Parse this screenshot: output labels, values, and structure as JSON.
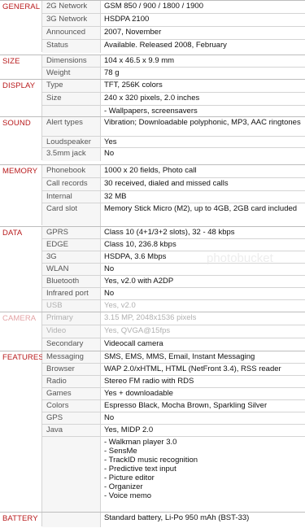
{
  "sections": [
    {
      "category": "GENERAL",
      "rows": [
        {
          "label": "2G Network",
          "value": "GSM 850 / 900 / 1800 / 1900"
        },
        {
          "label": "3G Network",
          "value": "HSDPA 2100"
        },
        {
          "label": "Announced",
          "value": "2007, November"
        },
        {
          "label": "Status",
          "value": "Available. Released 2008, February"
        }
      ]
    },
    {
      "category": "SIZE",
      "rows": [
        {
          "label": "Dimensions",
          "value": "104 x 46.5 x 9.9 mm"
        },
        {
          "label": "Weight",
          "value": "78 g"
        }
      ]
    },
    {
      "category": "DISPLAY",
      "rows": [
        {
          "label": "Type",
          "value": "TFT, 256K colors"
        },
        {
          "label": "Size",
          "value": "240 x 320 pixels, 2.0 inches"
        },
        {
          "label": "",
          "value": "- Wallpapers, screensavers"
        }
      ]
    },
    {
      "category": "SOUND",
      "rows": [
        {
          "label": "Alert types",
          "value": "Vibration; Downloadable polyphonic, MP3, AAC ringtones"
        },
        {
          "label": "Loudspeaker",
          "value": "Yes"
        },
        {
          "label": "3.5mm jack",
          "value": "No"
        }
      ]
    },
    {
      "category": "MEMORY",
      "rows": [
        {
          "label": "Phonebook",
          "value": "1000 x 20 fields, Photo call"
        },
        {
          "label": "Call records",
          "value": "30 received, dialed and missed calls"
        },
        {
          "label": "Internal",
          "value": "32 MB"
        },
        {
          "label": "Card slot",
          "value": "Memory Stick Micro (M2), up to 4GB, 2GB card included"
        }
      ]
    },
    {
      "category": "DATA",
      "rows": [
        {
          "label": "GPRS",
          "value": "Class 10 (4+1/3+2 slots), 32 - 48 kbps"
        },
        {
          "label": "EDGE",
          "value": "Class 10, 236.8 kbps"
        },
        {
          "label": "3G",
          "value": "HSDPA, 3.6 Mbps"
        },
        {
          "label": "WLAN",
          "value": "No"
        },
        {
          "label": "Bluetooth",
          "value": "Yes, v2.0 with A2DP"
        },
        {
          "label": "Infrared port",
          "value": "No"
        },
        {
          "label": "USB",
          "value": "Yes, v2.0"
        }
      ]
    },
    {
      "category": "CAMERA",
      "rows": [
        {
          "label": "Primary",
          "value": "3.15 MP, 2048x1536 pixels"
        },
        {
          "label": "Video",
          "value": "Yes, QVGA@15fps"
        },
        {
          "label": "Secondary",
          "value": "Videocall camera"
        }
      ]
    },
    {
      "category": "FEATURES",
      "rows": [
        {
          "label": "Messaging",
          "value": "SMS, EMS, MMS, Email, Instant Messaging"
        },
        {
          "label": "Browser",
          "value": "WAP 2.0/xHTML, HTML (NetFront 3.4), RSS reader"
        },
        {
          "label": "Radio",
          "value": "Stereo FM radio with RDS"
        },
        {
          "label": "Games",
          "value": "Yes + downloadable"
        },
        {
          "label": "Colors",
          "value": "Espresso Black, Mocha Brown, Sparkling Silver"
        },
        {
          "label": "GPS",
          "value": "No"
        },
        {
          "label": "Java",
          "value": "Yes, MIDP 2.0"
        },
        {
          "label": "",
          "value": "- Walkman player 3.0\n- SensMe\n- TrackID music recognition\n- Predictive text input\n- Picture editor\n- Organizer\n- Voice memo"
        }
      ]
    },
    {
      "category": "BATTERY",
      "rows": [
        {
          "label": "",
          "value": "Standard battery, Li-Po 950 mAh (BST-33)"
        }
      ]
    }
  ]
}
